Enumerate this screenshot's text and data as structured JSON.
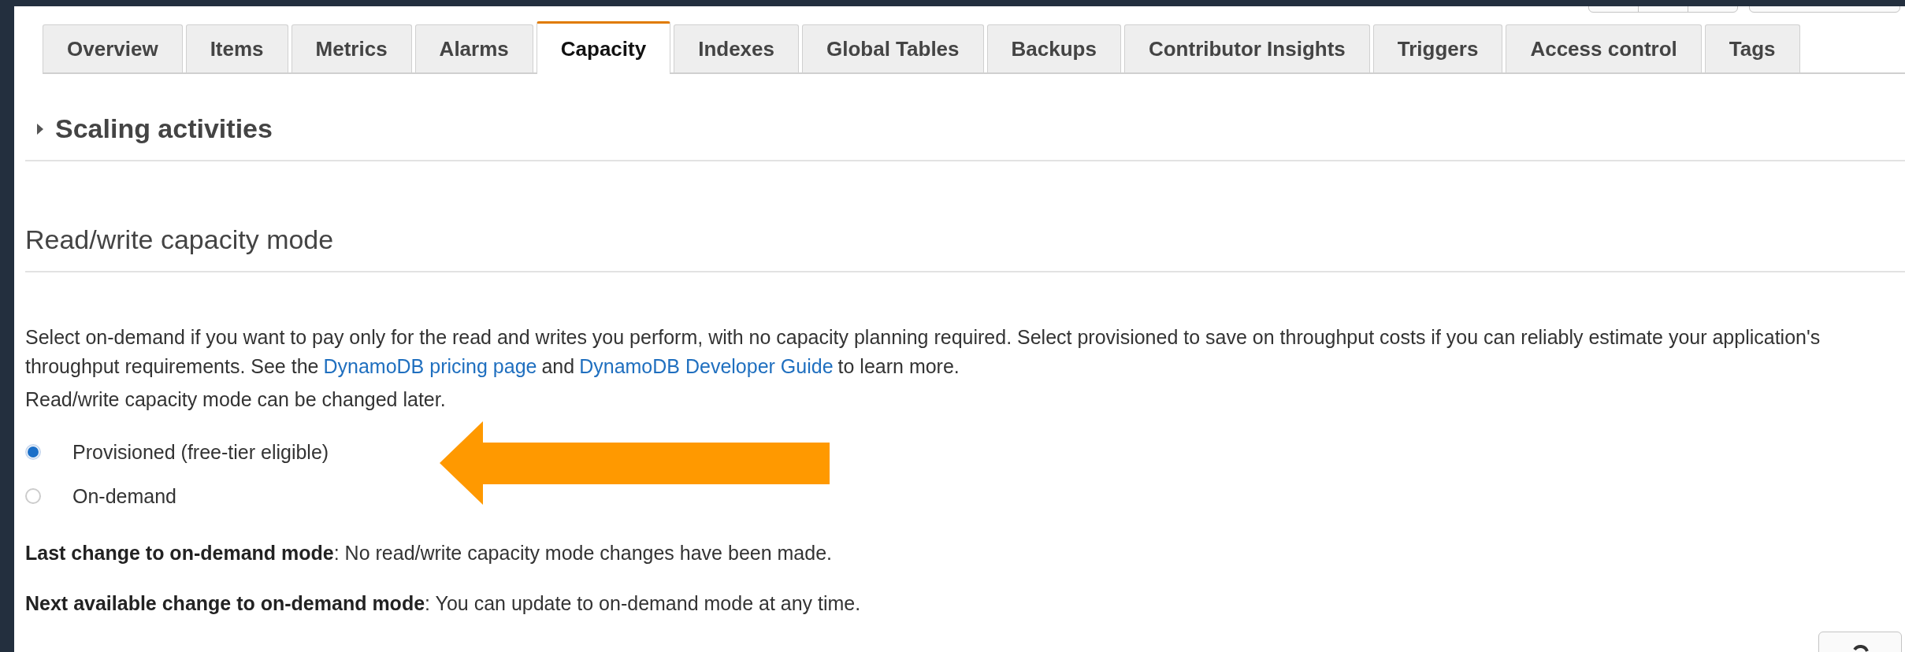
{
  "tabs": [
    {
      "label": "Overview",
      "selected": false
    },
    {
      "label": "Items",
      "selected": false
    },
    {
      "label": "Metrics",
      "selected": false
    },
    {
      "label": "Alarms",
      "selected": false
    },
    {
      "label": "Capacity",
      "selected": true
    },
    {
      "label": "Indexes",
      "selected": false
    },
    {
      "label": "Global Tables",
      "selected": false
    },
    {
      "label": "Backups",
      "selected": false
    },
    {
      "label": "Contributor Insights",
      "selected": false
    },
    {
      "label": "Triggers",
      "selected": false
    },
    {
      "label": "Access control",
      "selected": false
    },
    {
      "label": "Tags",
      "selected": false
    }
  ],
  "scaling_activities": {
    "title": "Scaling activities",
    "expanded": false
  },
  "capacity_mode": {
    "heading": "Read/write capacity mode",
    "description": [
      {
        "kind": "text",
        "text": "Select on-demand if you want to pay only for the read and writes you perform, with no capacity planning required. Select provisioned to save on throughput costs if you can reliably estimate your application's throughput requirements. See the"
      },
      {
        "kind": "link",
        "text": "DynamoDB pricing page"
      },
      {
        "kind": "text",
        "text": "and"
      },
      {
        "kind": "link",
        "text": "DynamoDB Developer Guide"
      },
      {
        "kind": "text",
        "text": "to learn more."
      }
    ],
    "note": "Read/write capacity mode can be changed later.",
    "options": [
      {
        "label": "Provisioned (free-tier eligible)",
        "selected": true
      },
      {
        "label": "On-demand",
        "selected": false
      }
    ],
    "status": [
      "**Last change to on-demand mode**: No read/write capacity mode changes have been made.",
      "**Next available change to on-demand mode**: You can update to on-demand mode at any time."
    ]
  }
}
